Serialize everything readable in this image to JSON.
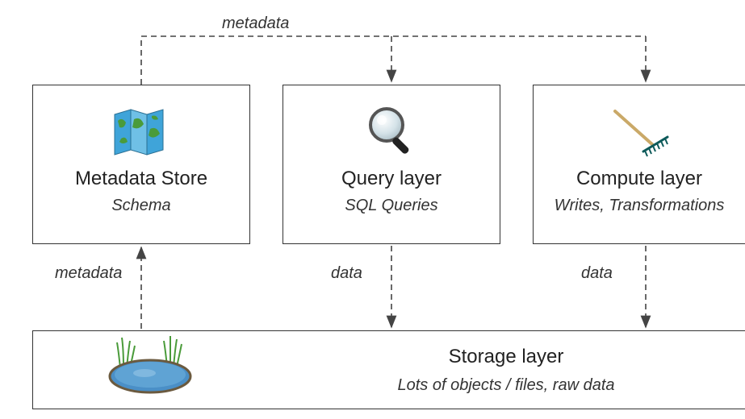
{
  "top_label": "metadata",
  "boxes": {
    "metadata_store": {
      "title": "Metadata Store",
      "subtitle": "Schema",
      "icon": "map-icon"
    },
    "query_layer": {
      "title": "Query layer",
      "subtitle": "SQL Queries",
      "icon": "magnifier-icon"
    },
    "compute_layer": {
      "title": "Compute layer",
      "subtitle": "Writes, Transformations",
      "icon": "rake-icon"
    },
    "storage_layer": {
      "title": "Storage layer",
      "subtitle": "Lots of objects / files, raw data",
      "icon": "pond-icon"
    }
  },
  "edge_labels": {
    "metadata_up": "metadata",
    "query_down": "data",
    "compute_down": "data"
  },
  "layout_hint": "Three top boxes (Metadata Store, Query layer, Compute layer) above a wide Storage layer box. Dashed arrows: metadata flows from Metadata Store up and across to Query and Compute; metadata flows from Storage up to Metadata Store; data flows from Query and Compute down to Storage."
}
